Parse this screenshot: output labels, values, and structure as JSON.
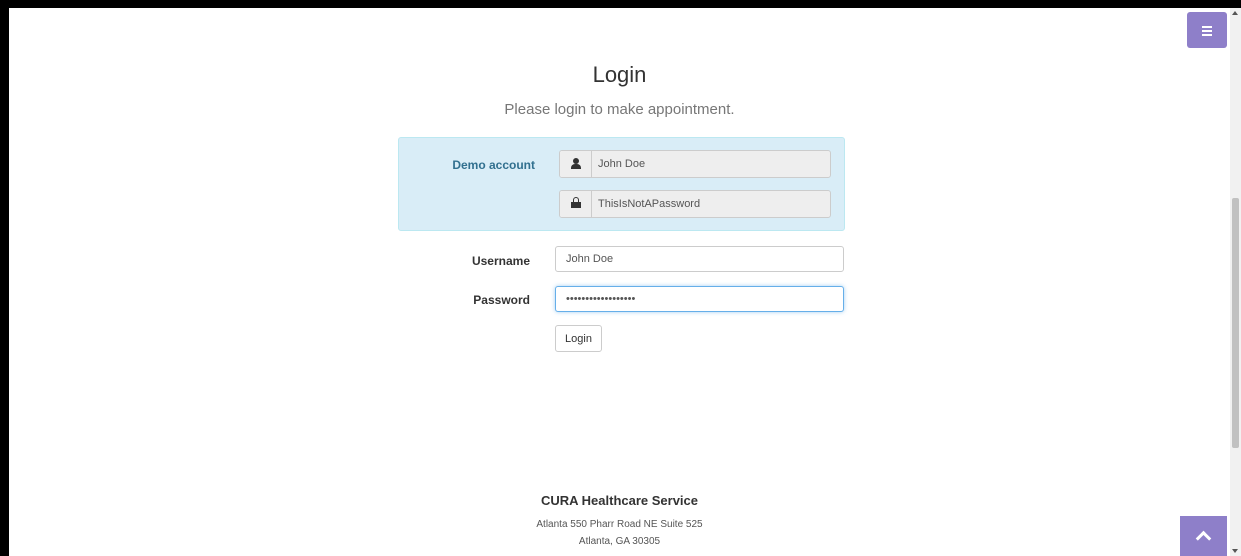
{
  "page": {
    "title": "Login",
    "subtitle": "Please login to make appointment."
  },
  "demo": {
    "label": "Demo account",
    "username": "John Doe",
    "password": "ThisIsNotAPassword",
    "user_icon": "user-icon",
    "lock_icon": "lock-icon"
  },
  "form": {
    "username_label": "Username",
    "username_value": "John Doe",
    "password_label": "Password",
    "password_value": "ThisIsNotAPassword",
    "login_label": "Login"
  },
  "footer": {
    "title": "CURA Healthcare Service",
    "address_line1": "Atlanta 550 Pharr Road NE Suite 525",
    "address_line2": "Atlanta, GA 30305"
  },
  "icons": {
    "menu": "menu-icon",
    "to_top": "chevron-up-icon"
  },
  "colors": {
    "accent": "#8e7fc9",
    "demo_bg": "#d9edf7",
    "demo_label": "#31708f",
    "focus": "#66afe9"
  }
}
